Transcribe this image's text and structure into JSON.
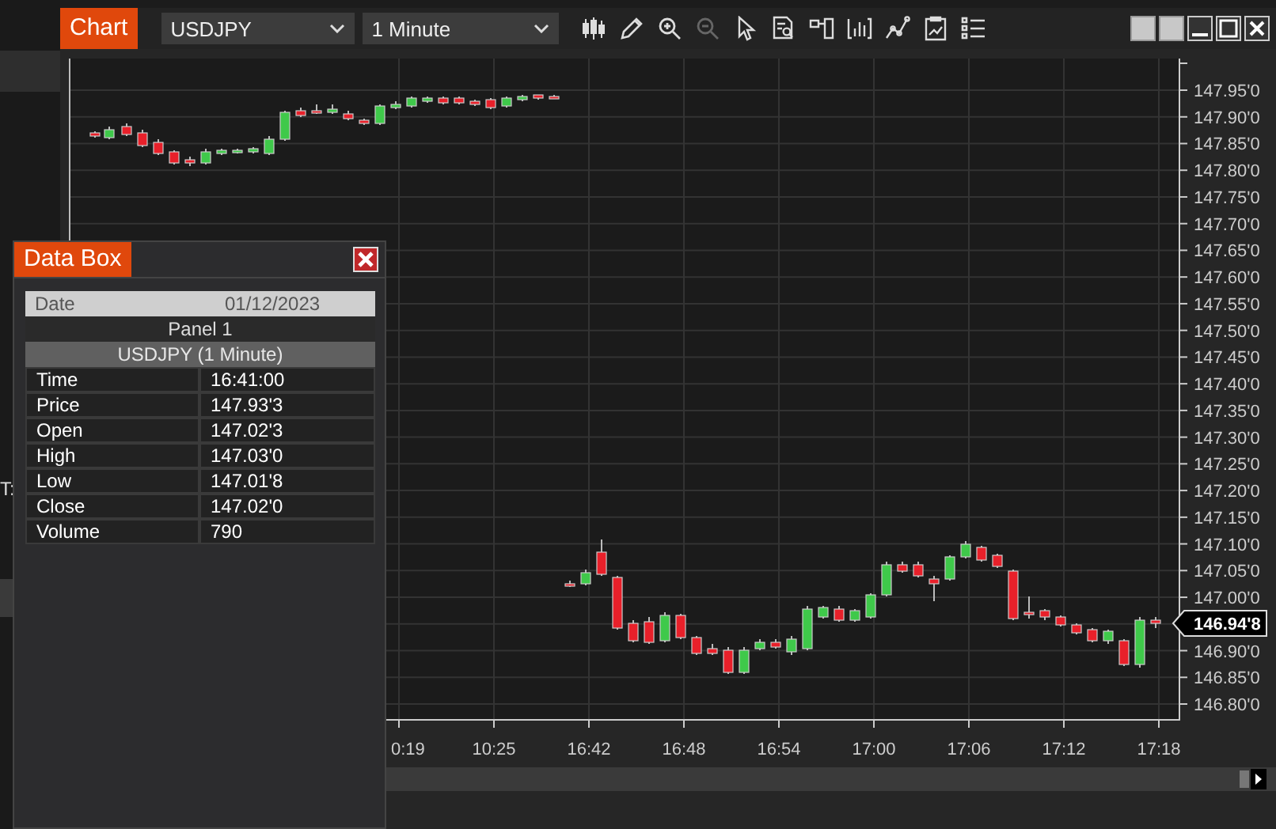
{
  "background": {
    "side_label": "T:"
  },
  "chart_window": {
    "title": "Chart",
    "instrument": "USDJPY",
    "interval": "1 Minute",
    "current_price": "146.94'8",
    "price_axis": [
      "147.95'0",
      "147.90'0",
      "147.85'0",
      "147.80'0",
      "147.75'0",
      "147.70'0",
      "147.65'0",
      "147.60'0",
      "147.55'0",
      "147.50'0",
      "147.45'0",
      "147.40'0",
      "147.35'0",
      "147.30'0",
      "147.25'0",
      "147.20'0",
      "147.15'0",
      "147.10'0",
      "147.05'0",
      "147.00'0",
      "146.90'0",
      "146.85'0",
      "146.80'0"
    ],
    "time_axis": [
      "0:19",
      "10:25",
      "16:42",
      "16:48",
      "16:54",
      "17:00",
      "17:06",
      "17:12",
      "17:18"
    ]
  },
  "data_box": {
    "title": "Data Box",
    "header": {
      "label": "Date",
      "value": "01/12/2023"
    },
    "panel": "Panel 1",
    "series": "USDJPY (1 Minute)",
    "rows": [
      {
        "label": "Time",
        "value": "16:41:00"
      },
      {
        "label": "Price",
        "value": "147.93'3"
      },
      {
        "label": "Open",
        "value": "147.02'3"
      },
      {
        "label": "High",
        "value": "147.03'0"
      },
      {
        "label": "Low",
        "value": "147.01'8"
      },
      {
        "label": "Close",
        "value": "147.02'0"
      },
      {
        "label": "Volume",
        "value": "790"
      }
    ]
  }
}
